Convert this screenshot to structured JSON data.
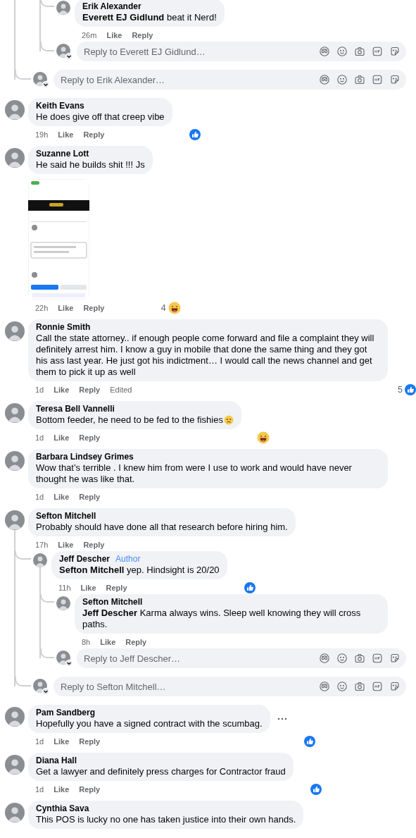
{
  "comments": [
    {
      "kind": "continued",
      "replies": [
        {
          "kind": "continued",
          "replies": [
            {
              "kind": "comment",
              "author": "Erik Alexander",
              "text": "**Everett EJ Gidlund** beat it Nerd!",
              "time": "26m",
              "actions": [
                "Like",
                "Reply"
              ]
            },
            {
              "kind": "reply_box",
              "placeholder": "Reply to Everett EJ Gidlund…"
            }
          ]
        },
        {
          "kind": "reply_box",
          "placeholder": "Reply to Erik Alexander…"
        }
      ]
    },
    {
      "kind": "comment",
      "author": "Keith Evans",
      "text": "He does give off that creep vibe",
      "time": "19h",
      "actions": [
        "Like",
        "Reply"
      ],
      "reactions": [
        {
          "kind": "like"
        }
      ]
    },
    {
      "kind": "comment",
      "author": "Suzanne Lott",
      "text": "He said he builds shit !!! Js",
      "attachment": {
        "kind": "picture"
      },
      "time": "22h",
      "actions": [
        "Like",
        "Reply"
      ],
      "reaction_count": "4",
      "reactions": [
        {
          "kind": "haha"
        }
      ]
    },
    {
      "kind": "comment",
      "author": "Ronnie Smith",
      "text": "Call the state attorney.. if enough people come forward and file a complaint they will definitely arrest him. I know a guy in mobile that done the same thing and they got his ass last year. He just got his indictment… I would call the news channel and get them to pick it up as well",
      "time": "1d",
      "actions": [
        "Like",
        "Reply"
      ],
      "edited": "Edited",
      "reaction_count": "5",
      "reactions": [
        {
          "kind": "like"
        }
      ]
    },
    {
      "kind": "comment",
      "author": "Teresa Bell Vannelli",
      "text": "Bottom feeder, he need to be fed to the fishies",
      "emoji": true,
      "time": "1d",
      "actions": [
        "Like",
        "Reply"
      ],
      "reactions": [
        {
          "kind": "haha"
        }
      ]
    },
    {
      "kind": "comment",
      "author": "Barbara Lindsey Grimes",
      "text": "Wow that’s terrible . I knew him from were I use to work and would have never thought he was like that.",
      "time": "1d",
      "actions": [
        "Like",
        "Reply"
      ]
    },
    {
      "kind": "comment",
      "author": "Sefton Mitchell",
      "text": "Probably should have done all that research before hiring him.",
      "time": "17h",
      "actions": [
        "Like",
        "Reply"
      ],
      "replies": [
        {
          "kind": "comment",
          "author": "Jeff Descher",
          "badge": "Author",
          "text": "**Sefton Mitchell** yep. Hindsight is 20/20",
          "time": "11h",
          "actions": [
            "Like",
            "Reply"
          ],
          "reactions": [
            {
              "kind": "like"
            }
          ],
          "replies": [
            {
              "kind": "comment",
              "author": "Sefton Mitchell",
              "text": "**Jeff Descher** Karma always wins. Sleep well knowing they will cross paths.",
              "time": "8h",
              "actions": [
                "Like",
                "Reply"
              ]
            },
            {
              "kind": "reply_box",
              "placeholder": "Reply to Jeff Descher…"
            }
          ]
        },
        {
          "kind": "reply_box",
          "placeholder": "Reply to Sefton Mitchell…"
        }
      ]
    },
    {
      "kind": "comment",
      "author": "Pam Sandberg",
      "text": "Hopefully you have a signed contract with the scumbag.",
      "menu": true,
      "time": "1d",
      "actions": [
        "Like",
        "Reply"
      ],
      "reactions": [
        {
          "kind": "like"
        }
      ]
    },
    {
      "kind": "comment",
      "author": "Diana Hall",
      "text": "Get a lawyer and definitely press charges for Contractor fraud",
      "time": "1d",
      "actions": [
        "Like",
        "Reply"
      ],
      "reactions": [
        {
          "kind": "like"
        }
      ]
    },
    {
      "kind": "comment",
      "author": "Cynthia Sava",
      "text": "This POS is lucky no one has taken justice into their own hands."
    }
  ]
}
